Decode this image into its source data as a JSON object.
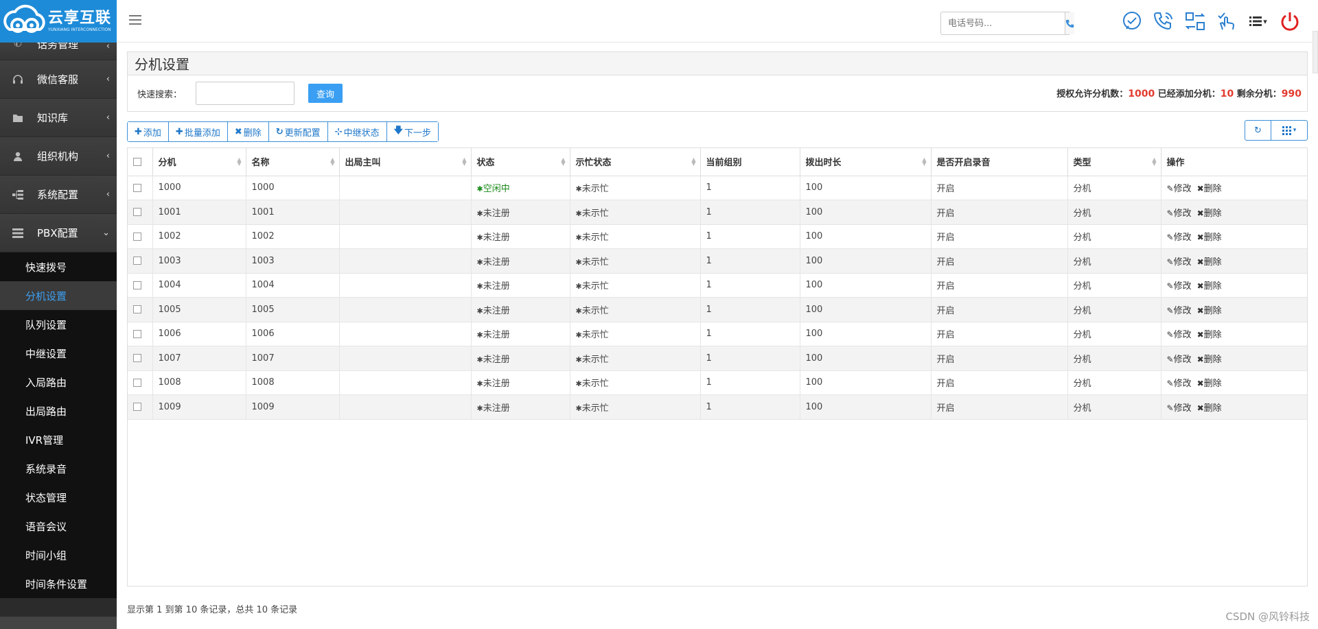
{
  "logo": {
    "cn": "云享互联",
    "en": "YUNXIANG INTERCONNECTION"
  },
  "sidebar": {
    "items": [
      {
        "label": "话务管理",
        "icon": "phone-icon"
      },
      {
        "label": "微信客服",
        "icon": "headset-icon"
      },
      {
        "label": "知识库",
        "icon": "folder-icon"
      },
      {
        "label": "组织机构",
        "icon": "user-icon"
      },
      {
        "label": "系统配置",
        "icon": "sitemap-icon"
      },
      {
        "label": "PBX配置",
        "icon": "server-icon"
      }
    ],
    "sub_items": [
      "快速拨号",
      "分机设置",
      "队列设置",
      "中继设置",
      "入局路由",
      "出局路由",
      "IVR管理",
      "系统录音",
      "状态管理",
      "语音会议",
      "时间小组",
      "时间条件设置"
    ],
    "active_sub": "分机设置"
  },
  "topbar": {
    "phone_placeholder": "电话号码...",
    "icons": [
      "check-chat-icon",
      "phone-ring-icon",
      "transfer-icon",
      "hand-check-icon",
      "list-dropdown-icon",
      "power-icon"
    ]
  },
  "page": {
    "title": "分机设置",
    "quick_search_label": "快速搜索：",
    "query_button": "查询",
    "license": {
      "allowed_label": "授权允许分机数：",
      "allowed": "1000",
      "added_label": " 已经添加分机：",
      "added": "10",
      "remaining_label": " 剩余分机：",
      "remaining": "990"
    }
  },
  "toolbar": {
    "add": "添加",
    "batch_add": "批量添加",
    "delete": "删除",
    "update_config": "更新配置",
    "trunk_status": "中继状态",
    "next_step": "下一步"
  },
  "table": {
    "headers": [
      "分机",
      "名称",
      "出局主叫",
      "状态",
      "示忙状态",
      "当前组别",
      "拨出时长",
      "是否开启录音",
      "类型",
      "操作"
    ],
    "edit_label": "修改",
    "delete_label": "删除",
    "rows": [
      {
        "ext": "1000",
        "name": "1000",
        "caller": "",
        "status": "空闲中",
        "busy": "未示忙",
        "group": "1",
        "duration": "100",
        "record": "开启",
        "type": "分机"
      },
      {
        "ext": "1001",
        "name": "1001",
        "caller": "",
        "status": "未注册",
        "busy": "未示忙",
        "group": "1",
        "duration": "100",
        "record": "开启",
        "type": "分机"
      },
      {
        "ext": "1002",
        "name": "1002",
        "caller": "",
        "status": "未注册",
        "busy": "未示忙",
        "group": "1",
        "duration": "100",
        "record": "开启",
        "type": "分机"
      },
      {
        "ext": "1003",
        "name": "1003",
        "caller": "",
        "status": "未注册",
        "busy": "未示忙",
        "group": "1",
        "duration": "100",
        "record": "开启",
        "type": "分机"
      },
      {
        "ext": "1004",
        "name": "1004",
        "caller": "",
        "status": "未注册",
        "busy": "未示忙",
        "group": "1",
        "duration": "100",
        "record": "开启",
        "type": "分机"
      },
      {
        "ext": "1005",
        "name": "1005",
        "caller": "",
        "status": "未注册",
        "busy": "未示忙",
        "group": "1",
        "duration": "100",
        "record": "开启",
        "type": "分机"
      },
      {
        "ext": "1006",
        "name": "1006",
        "caller": "",
        "status": "未注册",
        "busy": "未示忙",
        "group": "1",
        "duration": "100",
        "record": "开启",
        "type": "分机"
      },
      {
        "ext": "1007",
        "name": "1007",
        "caller": "",
        "status": "未注册",
        "busy": "未示忙",
        "group": "1",
        "duration": "100",
        "record": "开启",
        "type": "分机"
      },
      {
        "ext": "1008",
        "name": "1008",
        "caller": "",
        "status": "未注册",
        "busy": "未示忙",
        "group": "1",
        "duration": "100",
        "record": "开启",
        "type": "分机"
      },
      {
        "ext": "1009",
        "name": "1009",
        "caller": "",
        "status": "未注册",
        "busy": "未示忙",
        "group": "1",
        "duration": "100",
        "record": "开启",
        "type": "分机"
      }
    ]
  },
  "footer": {
    "info": "显示第 1 到第 10 条记录，总共 10 条记录"
  },
  "watermark": "CSDN @风铃科技",
  "colors": {
    "accent": "#3a9ff3",
    "sidebar": "#2b2b2b",
    "idle": "#1a8a1a",
    "license_num": "#e23b2f"
  }
}
